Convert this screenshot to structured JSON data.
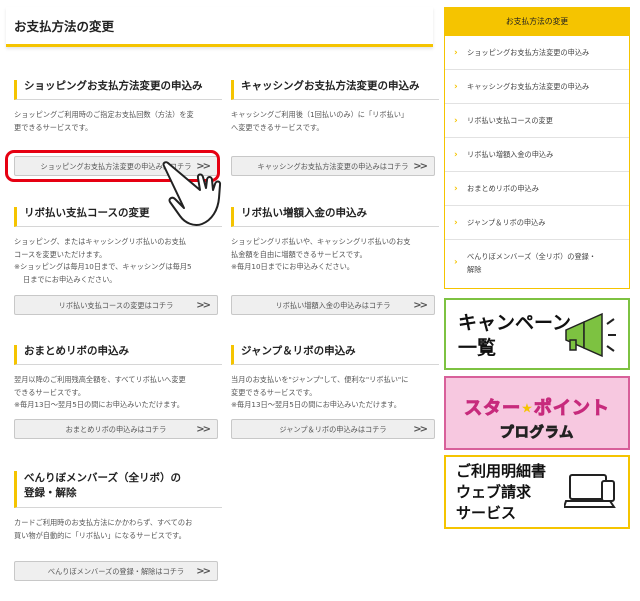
{
  "page_title": "お支払方法の変更",
  "sections": [
    {
      "title": "ショッピングお支払方法変更の申込み",
      "desc": [
        "ショッピングご利用時のご指定お支払回数（方法）を変",
        "更できるサービスです。"
      ],
      "button": "ショッピングお支払方法変更の申込みはコチラ"
    },
    {
      "title": "キャッシングお支払方法変更の申込み",
      "desc": [
        "キャッシングご利用後（1回払いのみ）に「リボ払い」",
        "へ変更できるサービスです。"
      ],
      "button": "キャッシングお支払方法変更の申込みはコチラ"
    },
    {
      "title": "リボ払い支払コースの変更",
      "desc": [
        "ショッピング、またはキャッシングリボ払いのお支払",
        "コースを変更いただけます。"
      ],
      "notes": [
        "※ショッピングは毎月10日まで、キャッシングは毎月5",
        "日までにお申込みください。"
      ],
      "button": "リボ払い支払コースの変更はコチラ"
    },
    {
      "title": "リボ払い増額入金の申込み",
      "desc": [
        "ショッピングリボ払いや、キャッシングリボ払いのお支",
        "払金額を自由に増額できるサービスです。"
      ],
      "notes": [
        "※毎月10日までにお申込みください。"
      ],
      "button": "リボ払い増額入金の申込みはコチラ"
    },
    {
      "title": "おまとめリボの申込み",
      "desc": [
        "翌月以降のご利用残高全額を、すべてリボ払いへ変更",
        "できるサービスです。"
      ],
      "notes": [
        "※毎月13日～翌月5日の間にお申込みいただけます。"
      ],
      "button": "おまとめリボの申込みはコチラ"
    },
    {
      "title": "ジャンプ＆リボの申込み",
      "desc": [
        "当月のお支払いを\"ジャンプ\"して、便利な\"リボ払い\"に",
        "変更できるサービスです。"
      ],
      "notes": [
        "※毎月13日～翌月5日の間にお申込みいただけます。"
      ],
      "button": "ジャンプ＆リボの申込みはコチラ"
    },
    {
      "title": "べんりぼメンバーズ（全リボ）の",
      "title2": "登録・解除",
      "desc": [
        "カードご利用時のお支払方法にかかわらず、すべてのお",
        "買い物が自動的に「リボ払い」になるサービスです。"
      ],
      "button": "べんりぼメンバーズの登録・解除はコチラ"
    }
  ],
  "sidebar": {
    "header": "お支払方法の変更",
    "items": [
      "ショッピングお支払方法変更の申込み",
      "キャッシングお支払方法変更の申込み",
      "リボ払い支払コースの変更",
      "リボ払い増額入金の申込み",
      "おまとめリボの申込み",
      "ジャンプ＆リボの申込み",
      "べんりぼメンバーズ（全リボ）の登録・",
      "解除"
    ]
  },
  "banners": {
    "campaign": [
      "キャンペーン",
      "一覧"
    ],
    "star_point": [
      "スター",
      "ポイント",
      "プログラム"
    ],
    "statement": [
      "ご利用明細書",
      "ウェブ請求",
      "サービス"
    ]
  },
  "icons": {
    "chevron": "chevron-double-right-icon",
    "sidebar_arrow": "chevron-right-icon",
    "pointer": "hand-pointer-icon"
  },
  "colors": {
    "accent": "#f5c400",
    "highlight": "#e60012",
    "campaign_border": "#7dc241",
    "star_border": "#d8609a"
  }
}
